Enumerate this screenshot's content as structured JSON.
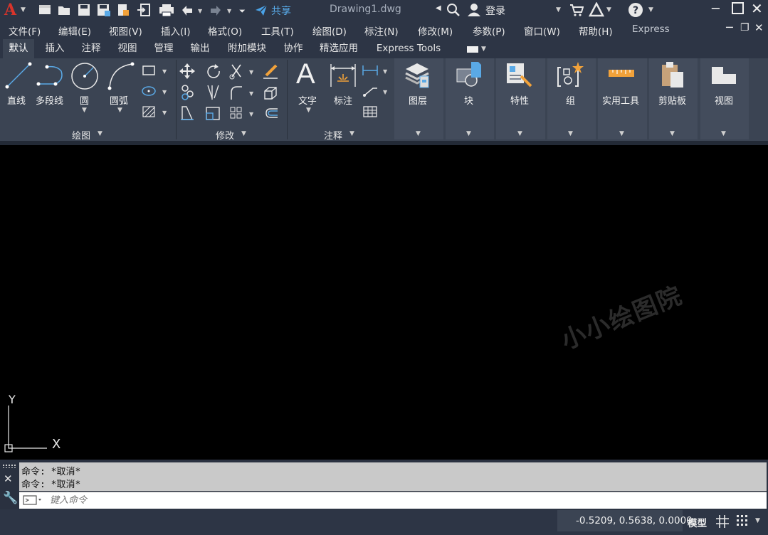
{
  "title_bar": {
    "app_menu_label": "A",
    "share_label": "共享",
    "document_title": "Drawing1.dwg",
    "signin_label": "登录"
  },
  "menu": [
    "文件(F)",
    "编辑(E)",
    "视图(V)",
    "插入(I)",
    "格式(O)",
    "工具(T)",
    "绘图(D)",
    "标注(N)",
    "修改(M)",
    "参数(P)",
    "窗口(W)",
    "帮助(H)",
    "Express"
  ],
  "tabs": [
    "默认",
    "插入",
    "注释",
    "视图",
    "管理",
    "输出",
    "附加模块",
    "协作",
    "精选应用",
    "Express Tools"
  ],
  "active_tab": "默认",
  "ribbon": {
    "draw": {
      "title": "绘图",
      "line": "直线",
      "polyline": "多段线",
      "circle": "圆",
      "arc": "圆弧"
    },
    "modify": {
      "title": "修改"
    },
    "annotation": {
      "title": "注释",
      "text": "文字",
      "dimension": "标注"
    },
    "layers": "图层",
    "block": "块",
    "properties": "特性",
    "groups": "组",
    "utilities": "实用工具",
    "clipboard": "剪贴板",
    "view": "视图"
  },
  "canvas": {
    "ucs_y": "Y",
    "ucs_x": "X",
    "watermark": "小小绘图院"
  },
  "command": {
    "history": [
      "命令: *取消*",
      "命令: *取消*"
    ],
    "placeholder": "键入命令"
  },
  "status": {
    "coordinates": "-0.5209, 0.5638, 0.0000",
    "model_label": "模型"
  },
  "colors": {
    "title_bg": "#2d3545",
    "ribbon_bg": "#3b4453",
    "canvas_bg": "#000000",
    "accent": "#5aa9e6",
    "app_logo": "#d9342b"
  }
}
